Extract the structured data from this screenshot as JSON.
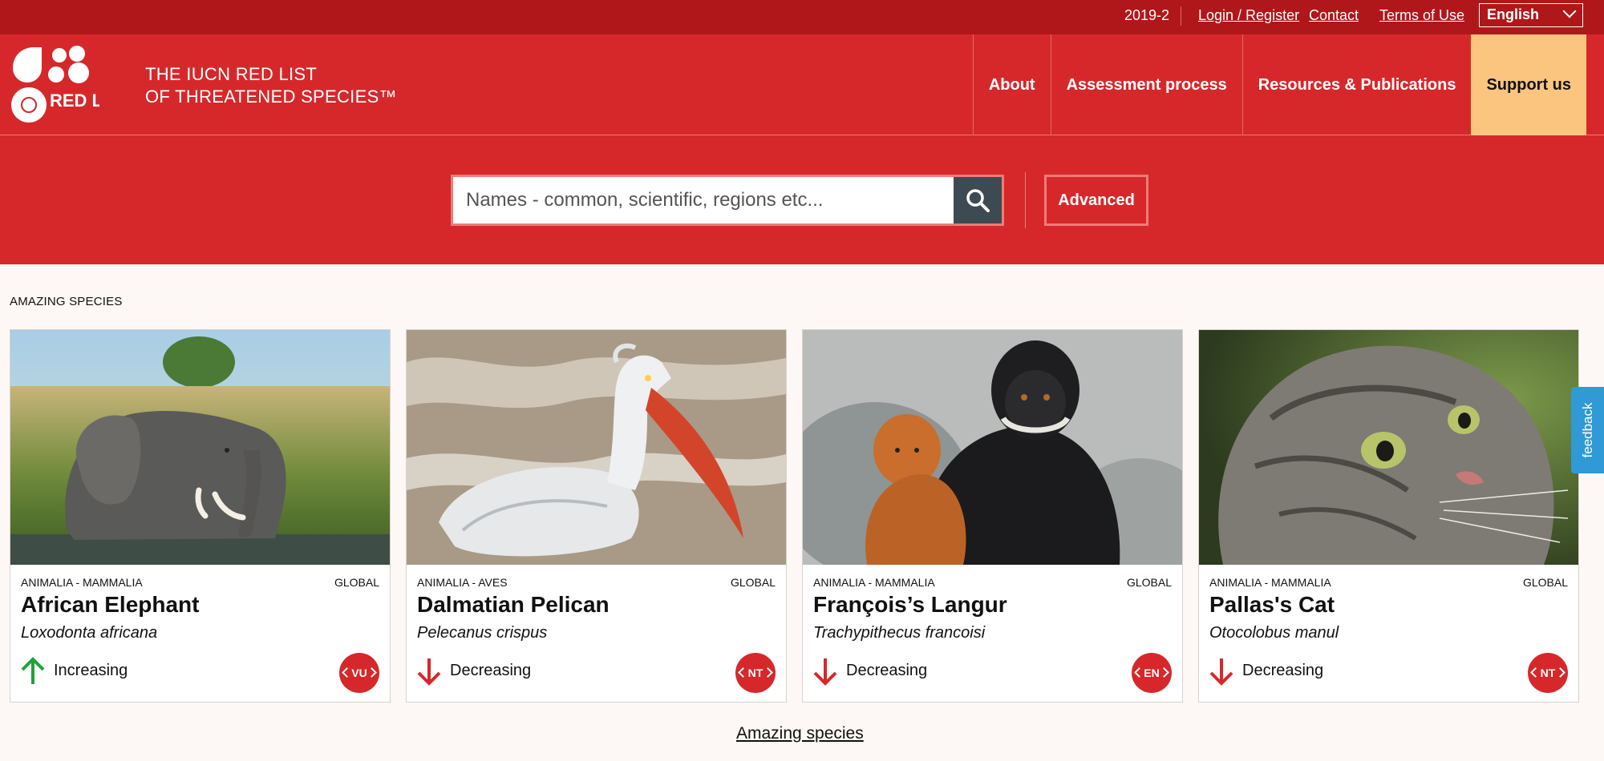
{
  "topbar": {
    "version": "2019-2",
    "links": [
      "Login / Register",
      "Contact",
      "Terms of Use"
    ],
    "language": "English"
  },
  "header": {
    "logo_text": "RED LIST",
    "title_line1": "THE IUCN RED LIST",
    "title_line2": "OF THREATENED SPECIES™",
    "nav": [
      "About",
      "Assessment process",
      "Resources & Publications"
    ],
    "support": "Support us"
  },
  "search": {
    "placeholder": "Names - common, scientific, regions etc...",
    "advanced": "Advanced"
  },
  "section": {
    "label": "AMAZING SPECIES",
    "more_link": "Amazing species"
  },
  "cards": [
    {
      "taxon": "ANIMALIA - MAMMALIA",
      "scope": "GLOBAL",
      "common": "African Elephant",
      "scientific": "Loxodonta africana",
      "trend": "Increasing",
      "status": "VU"
    },
    {
      "taxon": "ANIMALIA - AVES",
      "scope": "GLOBAL",
      "common": "Dalmatian Pelican",
      "scientific": "Pelecanus crispus",
      "trend": "Decreasing",
      "status": "NT"
    },
    {
      "taxon": "ANIMALIA - MAMMALIA",
      "scope": "GLOBAL",
      "common": "François’s Langur",
      "scientific": "Trachypithecus francoisi",
      "trend": "Decreasing",
      "status": "EN"
    },
    {
      "taxon": "ANIMALIA - MAMMALIA",
      "scope": "GLOBAL",
      "common": "Pallas's Cat",
      "scientific": "Otocolobus manul",
      "trend": "Decreasing",
      "status": "NT"
    }
  ],
  "feedback": "feedback",
  "colors": {
    "brand_red": "#d6282b",
    "topbar_red": "#b0171a",
    "support_bg": "#fbc47f",
    "increasing": "#1fa23c",
    "decreasing": "#d6282b",
    "feedback_blue": "#2f9ad5"
  }
}
